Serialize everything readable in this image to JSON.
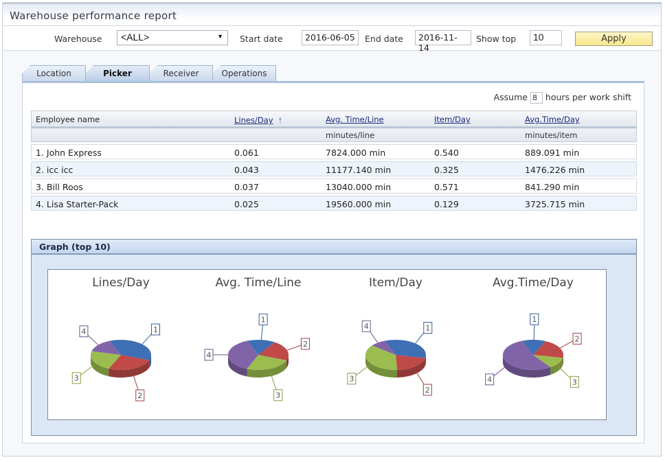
{
  "title": "Warehouse performance report",
  "filters": {
    "warehouse_label": "Warehouse",
    "warehouse_value": "<ALL>",
    "start_label": "Start date",
    "start_value": "2016-06-05",
    "end_label": "End date",
    "end_value": "2016-11-14",
    "showtop_label": "Show top",
    "showtop_value": "10",
    "apply_label": "Apply"
  },
  "tabs": [
    {
      "label": "Location",
      "active": false
    },
    {
      "label": "Picker",
      "active": true
    },
    {
      "label": "Receiver",
      "active": false
    },
    {
      "label": "Operations",
      "active": false
    }
  ],
  "assume": {
    "prefix": "Assume",
    "value": "8",
    "suffix": "hours per work shift"
  },
  "table": {
    "columns": [
      "Employee name",
      "Lines/Day",
      "Avg. Time/Line",
      "Item/Day",
      "Avg.Time/Day"
    ],
    "subheaders": [
      "",
      "",
      "minutes/line",
      "",
      "minutes/item"
    ],
    "sort_icon": "arrow-up-icon",
    "rows": [
      [
        "1.  John Express",
        "0.061",
        "7824.000 min",
        "0.540",
        "889.091 min"
      ],
      [
        "2.  icc icc",
        "0.043",
        "11177.140 min",
        "0.325",
        "1476.226 min"
      ],
      [
        "3.  Bill Roos",
        "0.037",
        "13040.000 min",
        "0.571",
        "841.290 min"
      ],
      [
        "4.  Lisa Starter-Pack",
        "0.025",
        "19560.000 min",
        "0.129",
        "3725.715 min"
      ]
    ]
  },
  "graph": {
    "title": "Graph (top 10)"
  },
  "colors": {
    "1": "#3f6fb5",
    "2": "#c04a48",
    "3": "#9bbd4f",
    "4": "#8164a8"
  },
  "chart_data": [
    {
      "type": "pie",
      "title": "Lines/Day",
      "labels": [
        "1",
        "2",
        "3",
        "4"
      ],
      "values": [
        0.061,
        0.043,
        0.037,
        0.025
      ]
    },
    {
      "type": "pie",
      "title": "Avg. Time/Line",
      "labels": [
        "1",
        "2",
        "3",
        "4"
      ],
      "values": [
        7824.0,
        11177.14,
        13040.0,
        19560.0
      ]
    },
    {
      "type": "pie",
      "title": "Item/Day",
      "labels": [
        "1",
        "2",
        "3",
        "4"
      ],
      "values": [
        0.54,
        0.325,
        0.571,
        0.129
      ]
    },
    {
      "type": "pie",
      "title": "Avg.Time/Day",
      "labels": [
        "1",
        "2",
        "3",
        "4"
      ],
      "values": [
        889.091,
        1476.226,
        841.29,
        3725.715
      ]
    }
  ]
}
